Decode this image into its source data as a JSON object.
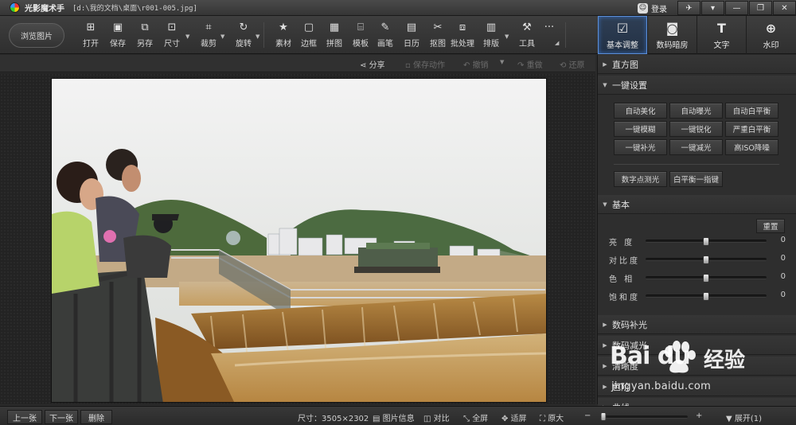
{
  "window": {
    "app_name": "光影魔术手",
    "file_path": "[d:\\我的文档\\桌面\\r001-005.jpg]",
    "login_label": "登录",
    "controls": [
      "✈",
      "▾",
      "—",
      "❐",
      "✕"
    ]
  },
  "toolbar": {
    "browse_label": "浏览图片",
    "tools": [
      {
        "label": "打开",
        "icon": "open-icon",
        "glyph": "⊞"
      },
      {
        "label": "保存",
        "icon": "save-icon",
        "glyph": "▣"
      },
      {
        "label": "另存",
        "icon": "save-as-icon",
        "glyph": "⧉"
      },
      {
        "label": "尺寸",
        "icon": "resize-icon",
        "glyph": "⊡"
      },
      {
        "label": "裁剪",
        "icon": "crop-icon",
        "glyph": "⌗"
      },
      {
        "label": "旋转",
        "icon": "rotate-icon",
        "glyph": "↻"
      },
      {
        "label": "素材",
        "icon": "material-icon",
        "glyph": "★"
      },
      {
        "label": "边框",
        "icon": "border-icon",
        "glyph": "▢"
      },
      {
        "label": "拼图",
        "icon": "puzzle-icon",
        "glyph": "▦"
      },
      {
        "label": "模板",
        "icon": "template-icon",
        "glyph": "⌸"
      },
      {
        "label": "画笔",
        "icon": "brush-icon",
        "glyph": "✎"
      },
      {
        "label": "日历",
        "icon": "calendar-icon",
        "glyph": "▤"
      },
      {
        "label": "抠图",
        "icon": "cutout-icon",
        "glyph": "✂"
      },
      {
        "label": "批处理",
        "icon": "batch-icon",
        "glyph": "⧈"
      },
      {
        "label": "排版",
        "icon": "layout-icon",
        "glyph": "▥"
      },
      {
        "label": "工具",
        "icon": "tools-icon",
        "glyph": "⚒"
      }
    ],
    "more_glyph": "···",
    "right_tabs": [
      {
        "label": "基本调整",
        "icon": "basic-adjust-icon",
        "glyph": "☑",
        "active": true
      },
      {
        "label": "数码暗房",
        "icon": "darkroom-icon",
        "glyph": "◙",
        "active": false
      },
      {
        "label": "文字",
        "icon": "text-icon",
        "glyph": "T",
        "active": false
      },
      {
        "label": "水印",
        "icon": "watermark-icon",
        "glyph": "⊕",
        "active": false
      }
    ]
  },
  "subbar": {
    "share": "分享",
    "save_action": "保存动作",
    "undo": "撤销",
    "redo": "重做",
    "restore": "还原"
  },
  "panel": {
    "histogram": "直方图",
    "one_click": "一键设置",
    "one_click_buttons": [
      "自动美化",
      "自动曝光",
      "自动白平衡",
      "一键模糊",
      "一键锐化",
      "严重白平衡",
      "一键补光",
      "一键减光",
      "高ISO降噪"
    ],
    "extra_buttons": [
      "数字点测光",
      "白平衡一指键"
    ],
    "basic": "基本",
    "reset": "重置",
    "sliders": [
      {
        "label": "亮 度",
        "value": 0
      },
      {
        "label": "对比度",
        "value": 0
      },
      {
        "label": "色 相",
        "value": 0
      },
      {
        "label": "饱和度",
        "value": 0
      }
    ],
    "sections_below": [
      "数码补光",
      "数码减光",
      "清晰度",
      "色阶",
      "曲线"
    ]
  },
  "status": {
    "prev": "上一张",
    "next": "下一张",
    "delete": "删除",
    "size": "尺寸：3505×2302",
    "info": "图片信息",
    "compare": "对比",
    "fullscreen": "全屏",
    "fit": "适屏",
    "original": "原大",
    "zoom_minus": "−",
    "zoom_plus": "+",
    "zoom_fraction": 0.04,
    "expand": "展开(1)"
  },
  "watermark": {
    "logo": "Bai  du",
    "jingyan": "经验",
    "url": "jingyan.baidu.com"
  }
}
